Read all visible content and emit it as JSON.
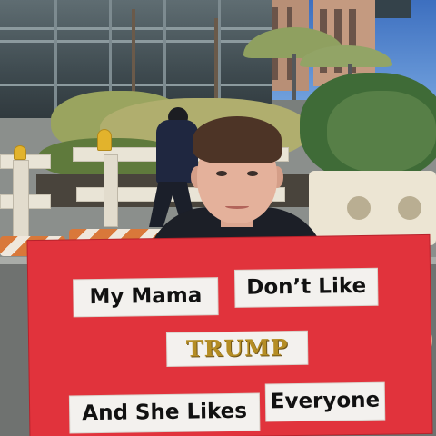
{
  "sign": {
    "line1_left": "My Mama",
    "line1_right": "Don’t Like",
    "name": "TRUMP",
    "line3_left": "And She Likes",
    "line3_right": "Everyone"
  },
  "colors": {
    "sign": "#e1333c",
    "label": "#f3f1ee",
    "name_text": "#b58d24",
    "jacket": "#1c1f27",
    "hair": "#4d3426"
  }
}
